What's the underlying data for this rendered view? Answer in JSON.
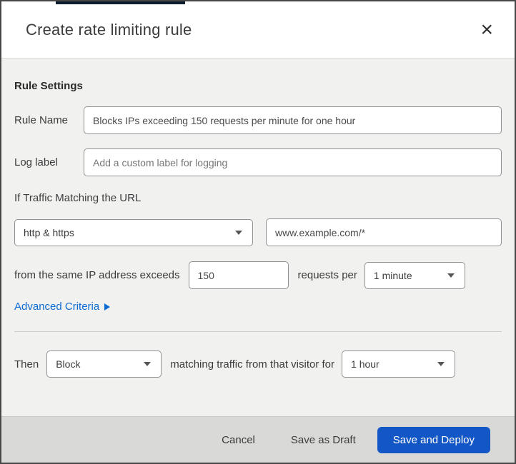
{
  "modal": {
    "title": "Create rate limiting rule",
    "close_glyph": "×"
  },
  "colors": {
    "accent_bar": "#0c1e30",
    "link_blue": "#0b6bd3",
    "deploy_button_blue": "#1357c6",
    "footer_bg": "#d9d9d8",
    "body_bg": "#f1f1f0"
  },
  "form": {
    "section_heading": "Rule Settings",
    "rule_name": {
      "label": "Rule Name",
      "value": "Blocks IPs exceeding 150 requests per minute for one hour"
    },
    "log_label": {
      "label": "Log label",
      "placeholder": "Add a custom label for logging"
    },
    "traffic_match": {
      "heading": "If Traffic Matching the URL",
      "scheme_selected": "http & https",
      "url_value": "www.example.com/*"
    },
    "threshold": {
      "prefix": "from the same IP address exceeds",
      "requests_value": "150",
      "middle": "requests per",
      "period_selected": "1 minute"
    },
    "advanced_criteria_label": "Advanced Criteria",
    "then": {
      "label": "Then",
      "action_selected": "Block",
      "middle": "matching traffic from that visitor for",
      "duration_selected": "1 hour"
    }
  },
  "footer": {
    "cancel_label": "Cancel",
    "save_draft_label": "Save as Draft",
    "save_deploy_label": "Save and Deploy"
  }
}
